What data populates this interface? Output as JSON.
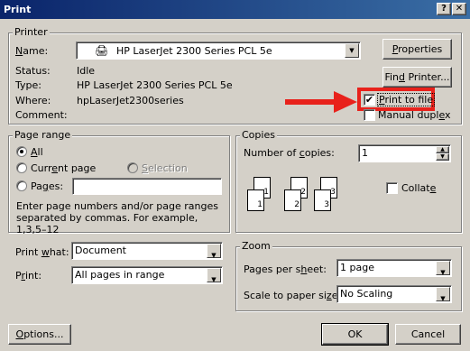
{
  "window": {
    "title": "Print",
    "help_label": "?",
    "close_label": "✕"
  },
  "printer": {
    "legend": "Printer",
    "name_label": "Name:",
    "name_value": "HP LaserJet 2300 Series PCL 5e",
    "status_label": "Status:",
    "status_value": "Idle",
    "type_label": "Type:",
    "type_value": "HP LaserJet 2300 Series PCL 5e",
    "where_label": "Where:",
    "where_value": "hpLaserJet2300series",
    "comment_label": "Comment:",
    "properties_label": "Properties",
    "find_printer_label": "Find Printer...",
    "print_to_file_label": "Print to file",
    "print_to_file_checked": true,
    "manual_duplex_label": "Manual duplex",
    "manual_duplex_checked": false
  },
  "annotation": {
    "highlight_color": "#e8211b"
  },
  "page_range": {
    "legend": "Page range",
    "all_label": "All",
    "current_page_label": "Current page",
    "selection_label": "Selection",
    "pages_label": "Pages:",
    "pages_value": "",
    "selected": "all",
    "hint": "Enter page numbers and/or page ranges separated by commas.  For example, 1,3,5–12"
  },
  "copies": {
    "legend": "Copies",
    "number_label": "Number of copies:",
    "number_value": "1",
    "collate_label": "Collate",
    "collate_checked": false,
    "collate_pages": [
      "1",
      "1",
      "2",
      "2",
      "3",
      "3"
    ]
  },
  "print_what": {
    "label": "Print what:",
    "value": "Document"
  },
  "print": {
    "label": "Print:",
    "value": "All pages in range"
  },
  "zoom": {
    "legend": "Zoom",
    "pages_per_sheet_label": "Pages per sheet:",
    "pages_per_sheet_value": "1 page",
    "scale_label": "Scale to paper size:",
    "scale_value": "No Scaling"
  },
  "footer": {
    "options_label": "Options...",
    "ok_label": "OK",
    "cancel_label": "Cancel"
  }
}
